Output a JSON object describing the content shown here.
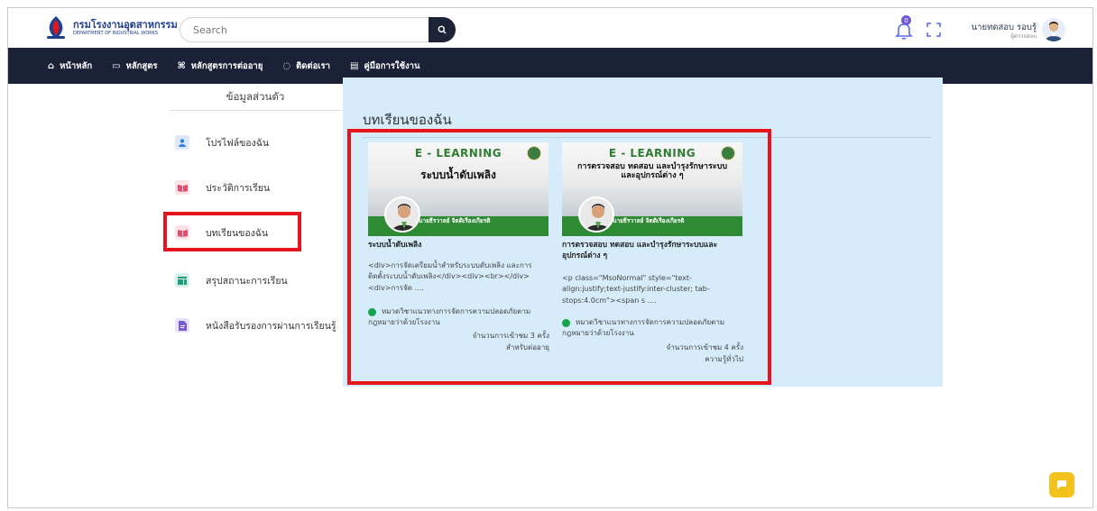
{
  "header": {
    "logo": {
      "name_th": "กรมโรงงานอุตสาหกรรม",
      "name_en": "DEPARTMENT OF INDUSTRIAL WORKS"
    },
    "search": {
      "placeholder": "Search"
    },
    "notifications": {
      "count": "0"
    },
    "user": {
      "name": "นายทดสอบ รอบรู้",
      "role": "ผู้ตรวจสอบ"
    }
  },
  "nav": {
    "items": [
      {
        "label": "หน้าหลัก",
        "icon": "home-icon"
      },
      {
        "label": "หลักสูตร",
        "icon": "monitor-icon"
      },
      {
        "label": "หลักสูตรการต่ออายุ",
        "icon": "command-icon"
      },
      {
        "label": "ติดต่อเรา",
        "icon": "chat-icon"
      },
      {
        "label": "คู่มือการใช้งาน",
        "icon": "book-icon"
      }
    ]
  },
  "sidebar": {
    "title": "ข้อมูลส่วนตัว",
    "items": [
      {
        "label": "โปรไฟล์ของฉัน",
        "icon": "user-icon",
        "color": "#2f7de0",
        "bg": "#dde9fb"
      },
      {
        "label": "ประวัติการเรียน",
        "icon": "book-open-icon",
        "color": "#e84a6a",
        "bg": "#fde2e8"
      },
      {
        "label": "บทเรียนของฉัน",
        "icon": "book-open-icon",
        "color": "#e84a6a",
        "bg": "#fde2e8"
      },
      {
        "label": "สรุปสถานะการเรียน",
        "icon": "chart-icon",
        "color": "#1f9d7a",
        "bg": "#d7f1e8"
      },
      {
        "label": "หนังสือรับรองการผ่านการเรียนรู้",
        "icon": "document-icon",
        "color": "#7b5bd6",
        "bg": "#e8e1fb"
      }
    ]
  },
  "main": {
    "title": "บทเรียนของฉัน",
    "courses": [
      {
        "thumb_head": "E - LEARNING",
        "thumb_sub": "ระบบน้ำดับเพลิง",
        "thumb_name": "นายธีรวาลย์ จิตติเรืองเกียรติ",
        "title": "ระบบน้ำดับเพลิง",
        "desc_line1": "<div>การจัดเตรียมน้ำสำหรับระบบดับเพลิง และการ",
        "desc_line2": "ติดตั้งระบบน้ำดับเพลิง</div><div><br></div>",
        "desc_line3": "<div>การจัด ....",
        "cat_line1": "หมวดวิชาแนวทางการจัดการความปลอดภัยตาม",
        "cat_line2": "กฎหมายว่าด้วยโรงงาน",
        "visits": "จำนวนการเข้าชม 3 ครั้ง",
        "type": "สำหรับต่ออายุ"
      },
      {
        "thumb_head": "E - LEARNING",
        "thumb_sub": "การตรวจสอบ ทดสอบ และบำรุงรักษาระบบ และอุปกรณ์ต่าง ๆ",
        "thumb_name": "นายธีรวาลย์ จิตติเรืองเกียรติ",
        "title_line1": "การตรวจสอบ ทดสอบ และบำรุงรักษาระบบและ",
        "title_line2": "อุปกรณ์ต่าง ๆ",
        "desc_line1": "<p class=\"MsoNormal\" style=\"text-",
        "desc_line2": "align:justify;text-justify:inter-cluster; tab-",
        "desc_line3": "stops:4.0cm\"><span s ....",
        "cat_line1": "หมวดวิชาแนวทางการจัดการความปลอดภัยตาม",
        "cat_line2": "กฎหมายว่าด้วยโรงงาน",
        "visits": "จำนวนการเข้าชม 4 ครั้ง",
        "type": "ความรู้ทั่วไป"
      }
    ]
  },
  "colors": {
    "nav_bg": "#1b2136",
    "panel_bg": "#d6ecfa",
    "highlight": "#e8141c",
    "category_dot": "#14a34a",
    "chat_button": "#f4c21d"
  }
}
